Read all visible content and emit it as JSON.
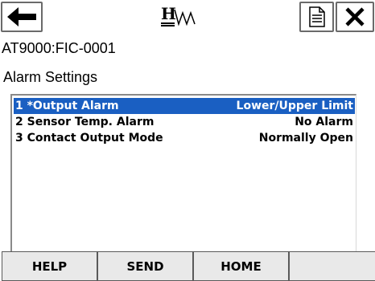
{
  "header": {
    "back_icon": "left-arrow-icon",
    "logo_icon": "hart-logo",
    "doc_icon": "document-icon",
    "close_icon": "close-icon"
  },
  "device_tag": "AT9000:FIC-0001",
  "screen_title": "Alarm Settings",
  "menu": {
    "items": [
      {
        "label": "1 *Output Alarm",
        "value": "Lower/Upper Limit",
        "selected": true
      },
      {
        "label": "2 Sensor Temp. Alarm",
        "value": "No Alarm",
        "selected": false
      },
      {
        "label": "3 Contact Output Mode",
        "value": "Normally Open",
        "selected": false
      }
    ]
  },
  "softkeys": {
    "help": "HELP",
    "send": "SEND",
    "home": "HOME",
    "empty": ""
  },
  "colors": {
    "selection": "#1a5fc2",
    "softkey_bg": "#e9e9e9"
  }
}
